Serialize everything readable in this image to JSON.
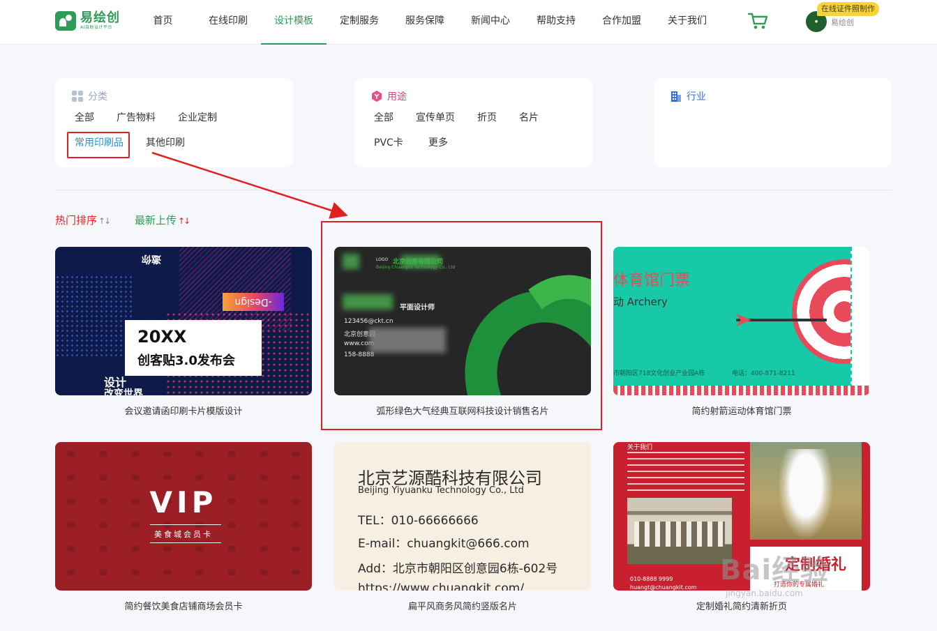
{
  "header": {
    "logo_name": "易绘创",
    "logo_sub": "AI自助设计平台",
    "nav": [
      "首页",
      "在线印刷",
      "设计模板",
      "定制服务",
      "服务保障",
      "新闻中心",
      "帮助支持",
      "合作加盟",
      "关于我们"
    ],
    "active_nav": "设计模板",
    "cart_icon": "cart-icon",
    "user_name": "易绘创",
    "badge": "在线证件照制作"
  },
  "filters": {
    "category": {
      "title": "分类",
      "icon": "grid-icon",
      "options": [
        "全部",
        "广告物料",
        "企业定制",
        "常用印刷品",
        "其他印刷"
      ],
      "selected": "常用印刷品"
    },
    "usage": {
      "title": "用途",
      "icon": "hexagon-icon",
      "options": [
        "全部",
        "宣传单页",
        "折页",
        "名片",
        "PVC卡",
        "更多"
      ]
    },
    "industry": {
      "title": "行业",
      "icon": "building-icon"
    }
  },
  "sort": {
    "hot": "热门排序",
    "new": "最新上传"
  },
  "templates": [
    {
      "caption": "会议邀请函印刷卡片模版设计",
      "thumb": {
        "heading": "20XX",
        "sub": "创客贴3.0发布会",
        "tag1": "设计",
        "tag2": "改变世界",
        "design": "-Design",
        "mirror": "邀你"
      }
    },
    {
      "caption": "弧形绿色大气经典互联网科技设计销售名片",
      "thumb": {
        "logo": "LOGO",
        "company": "北京创意有限公司",
        "company_en": "Beijing Chuangkit Technology Co., Ltd",
        "role": "平面设计师",
        "email": "123456@ckt.cn",
        "addr": "北京创意园",
        "web": "www.com",
        "phone": "158-8888"
      }
    },
    {
      "caption": "简约射箭运动体育馆门票",
      "thumb": {
        "title": "体育馆门票",
        "en": "动 Archery",
        "addr": "市朝阳区718文化创业产业园A栋",
        "tel": "电话：400-871-8211"
      }
    },
    {
      "caption": "简约餐饮美食店铺商场会员卡",
      "thumb": {
        "vip": "VIP",
        "sub": "美食城会员卡"
      }
    },
    {
      "caption": "扁平风商务风简约竖版名片",
      "thumb": {
        "company": "北京艺源酷科技有限公司",
        "company_en": "Beijing Yiyuanku Technology Co., Ltd",
        "tel": "TEL：010-66666666",
        "email": "E-mail：chuangkit@666.com",
        "addr": "Add：北京市朝阳区创意园6栋-602号",
        "web": "https://www.chuangkit.com/"
      }
    },
    {
      "caption": "定制婚礼简约清新折页",
      "thumb": {
        "about": "关于我们",
        "phone": "010-8888 9999",
        "email": "huangt@chuangkit.com",
        "big": "定制婚礼",
        "slogan": "打造你的专属婚礼"
      }
    }
  ],
  "watermark": {
    "text": "Bai经验",
    "sub": "jingyan.baidu.com"
  },
  "colors": {
    "accent": "#2e9c57",
    "annotation": "#e02020",
    "link_selected": "#2b8fd6"
  }
}
